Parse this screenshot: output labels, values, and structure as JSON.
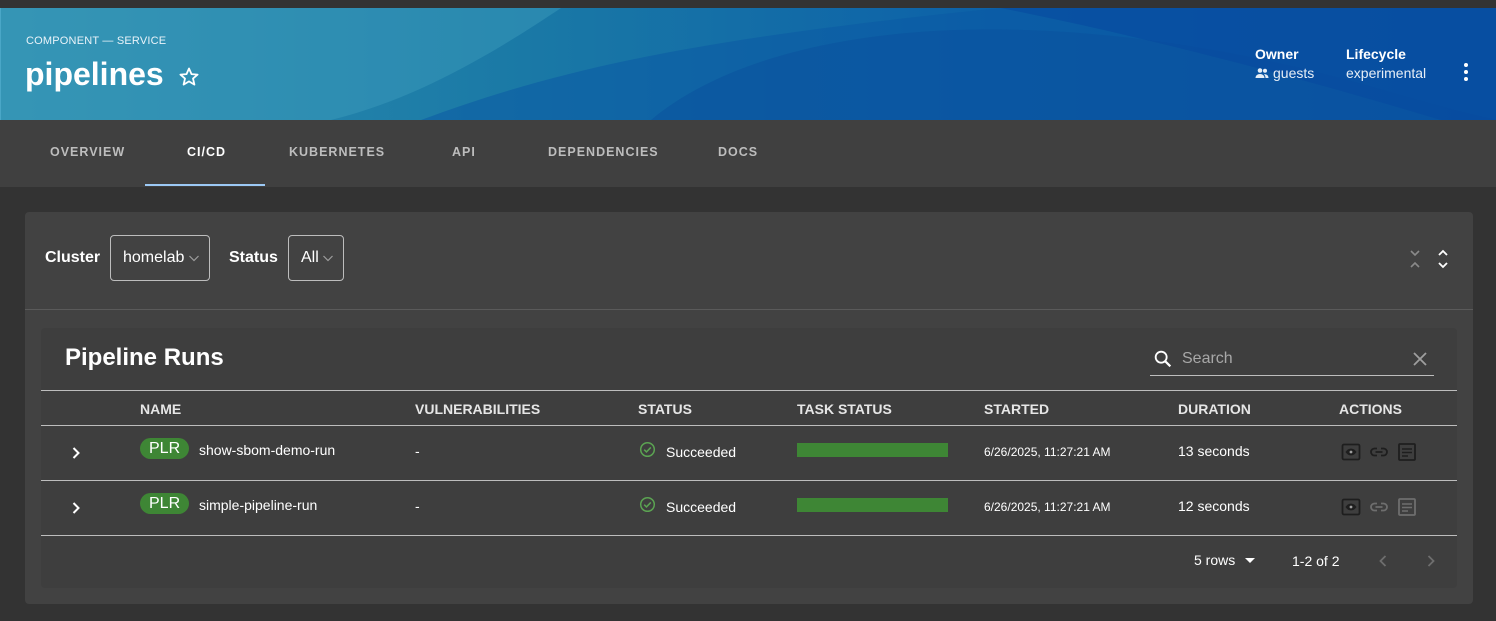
{
  "header": {
    "kind": "COMPONENT — SERVICE",
    "title": "pipelines",
    "owner_label": "Owner",
    "owner_value": "guests",
    "lifecycle_label": "Lifecycle",
    "lifecycle_value": "experimental"
  },
  "tabs": [
    {
      "label": "OVERVIEW"
    },
    {
      "label": "CI/CD"
    },
    {
      "label": "KUBERNETES"
    },
    {
      "label": "API"
    },
    {
      "label": "DEPENDENCIES"
    },
    {
      "label": "DOCS"
    }
  ],
  "active_tab": "CI/CD",
  "filters": {
    "cluster_label": "Cluster",
    "cluster_value": "homelab",
    "status_label": "Status",
    "status_value": "All"
  },
  "table": {
    "title": "Pipeline Runs",
    "search_placeholder": "Search",
    "columns": [
      "NAME",
      "VULNERABILITIES",
      "STATUS",
      "TASK STATUS",
      "STARTED",
      "DURATION",
      "ACTIONS"
    ],
    "rows": [
      {
        "badge": "PLR",
        "name": "show-sbom-demo-run",
        "vulnerabilities": "-",
        "status": "Succeeded",
        "task_status_fraction": 1.0,
        "started": "6/26/2025, 11:27:21 AM",
        "duration": "13 seconds"
      },
      {
        "badge": "PLR",
        "name": "simple-pipeline-run",
        "vulnerabilities": "-",
        "status": "Succeeded",
        "task_status_fraction": 1.0,
        "started": "6/26/2025, 11:27:21 AM",
        "duration": "12 seconds"
      }
    ],
    "rows_per_page": "5 rows",
    "pagination": "1-2 of 2"
  },
  "colors": {
    "success": "#3e8635",
    "active_tab_indicator": "#9cc9f5",
    "header_gradient_start": "#2f8fb0",
    "header_gradient_end": "#0750a3"
  }
}
